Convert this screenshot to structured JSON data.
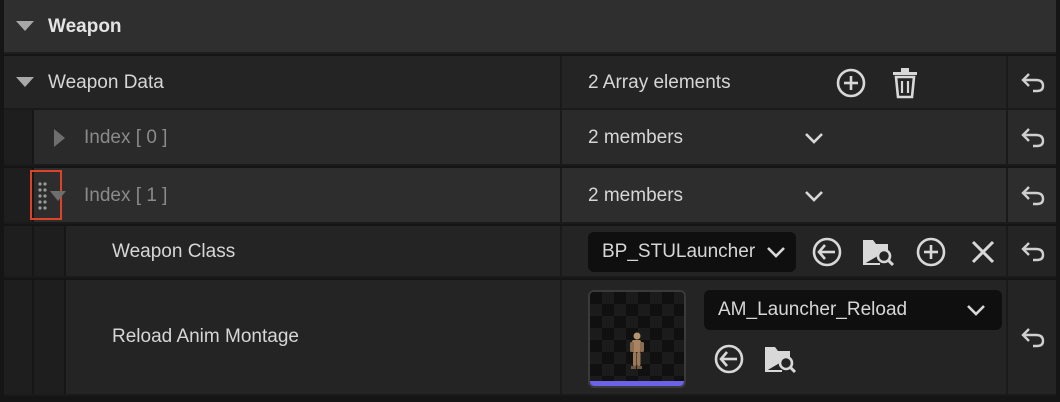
{
  "section": {
    "title": "Weapon"
  },
  "weapon_data": {
    "label": "Weapon Data",
    "summary": "2 Array elements",
    "items": [
      {
        "label": "Index [ 0 ]",
        "summary": "2 members",
        "expanded": false
      },
      {
        "label": "Index [ 1 ]",
        "summary": "2 members",
        "expanded": true,
        "fields": {
          "weapon_class": {
            "label": "Weapon Class",
            "value": "BP_STULauncher"
          },
          "reload_anim_montage": {
            "label": "Reload Anim Montage",
            "value": "AM_Launcher_Reload"
          }
        }
      }
    ]
  },
  "icons": {
    "add": "add-circle-icon",
    "delete": "trash-icon",
    "reset": "reset-to-default-icon",
    "dropdown": "chevron-down-icon",
    "use_selected": "use-selected-arrow-icon",
    "browse": "browse-folder-icon",
    "clear": "close-icon",
    "drag": "drag-handle-icon"
  },
  "colors": {
    "highlight": "#d9442b",
    "asset_bar": "#6b62e8"
  }
}
